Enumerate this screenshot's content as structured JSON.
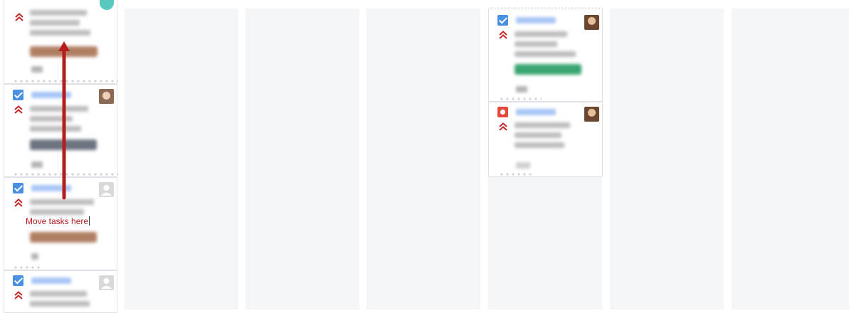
{
  "board": {
    "hint_text": "Move tasks here",
    "colors": {
      "column_bg": "#f4f5f7",
      "checkbox": "#4a90e2",
      "bug_icon": "#e5493a",
      "priority": "#c62828",
      "arrow": "#b71c1c",
      "tag_brown": "#b07f63",
      "tag_slate": "#6d7480",
      "tag_green": "#3aa570"
    },
    "columns": [
      {
        "cards": [
          {
            "issue_type": "check-icon",
            "priority": "highest",
            "tag_color": "tag_brown",
            "avatar": "teal-avatar"
          },
          {
            "issue_type": "check-icon",
            "priority": "highest",
            "tag_color": "tag_slate",
            "avatar": "photo-avatar"
          },
          {
            "issue_type": "check-icon",
            "priority": "highest",
            "tag_color": "tag_brown",
            "avatar": "default-avatar"
          },
          {
            "issue_type": "check-icon",
            "priority": "highest",
            "avatar": "default-avatar"
          }
        ]
      },
      {
        "cards": []
      },
      {
        "cards": []
      },
      {
        "cards": []
      },
      {
        "cards": [
          {
            "issue_type": "check-icon",
            "priority": "highest",
            "tag_color": "tag_green",
            "avatar": "photo-avatar"
          },
          {
            "issue_type": "bug-icon",
            "priority": "highest",
            "avatar": "photo-avatar"
          }
        ]
      },
      {
        "cards": []
      },
      {
        "cards": []
      }
    ]
  }
}
